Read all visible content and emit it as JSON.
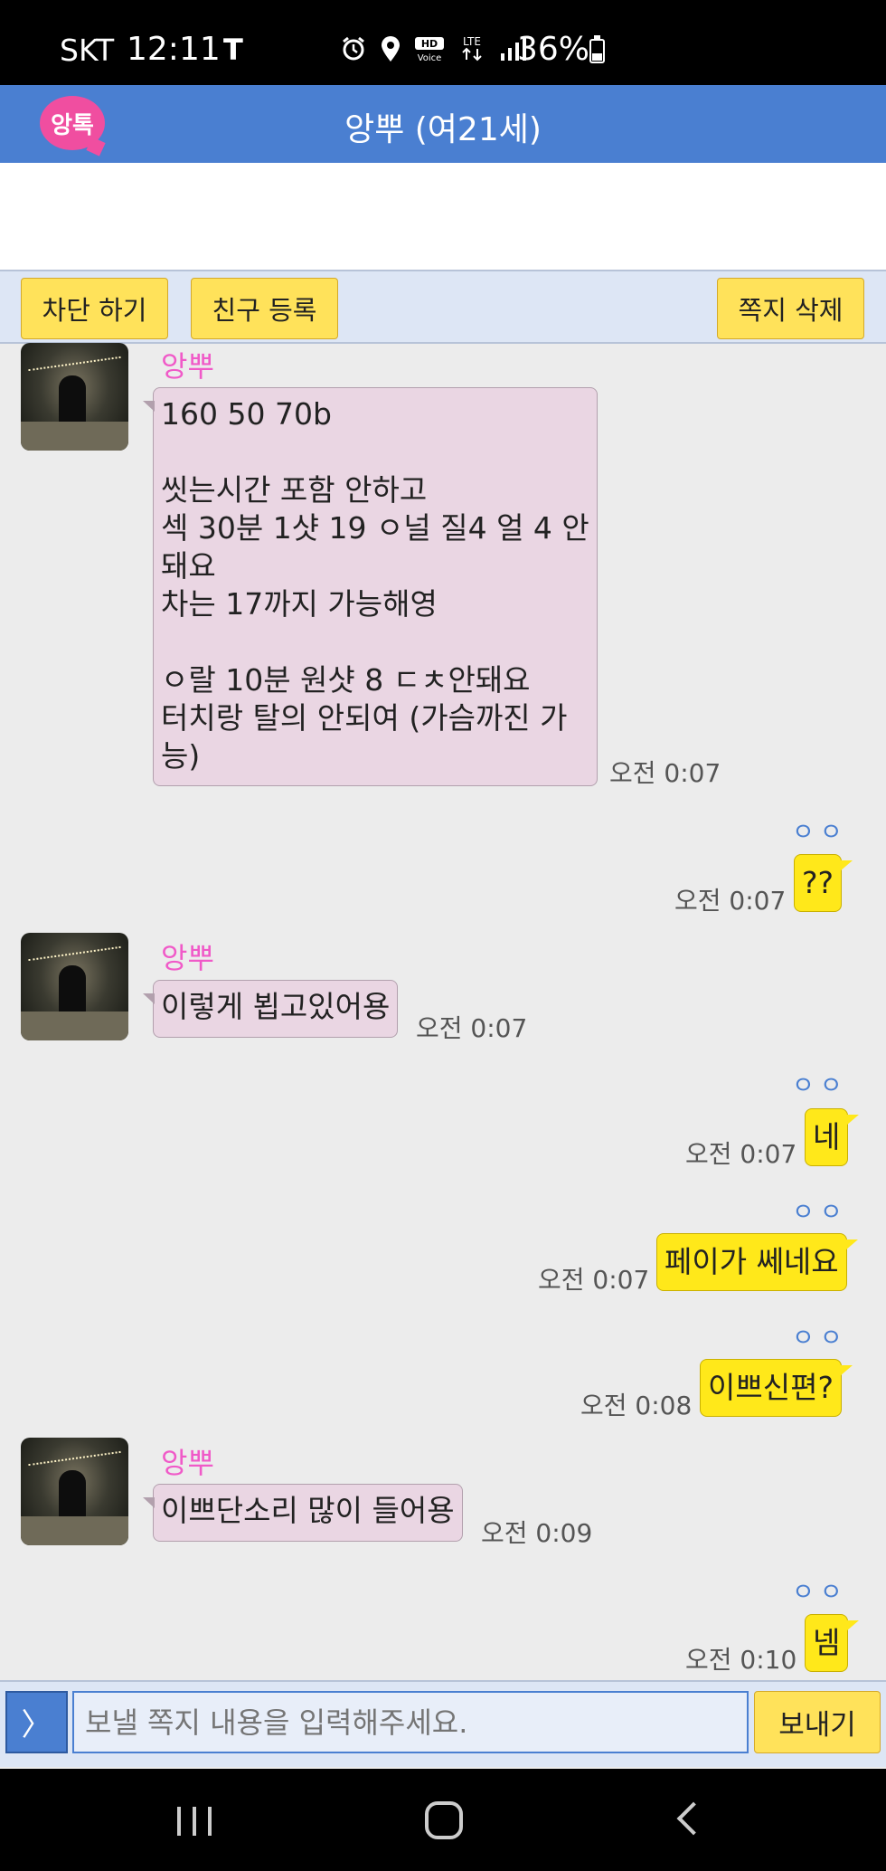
{
  "status_bar": {
    "carrier": "SKT",
    "time": "12:11",
    "carrier_icon": "T",
    "icons": [
      "alarm-icon",
      "location-icon",
      "hd-voice-icon",
      "lte-icon",
      "signal-icon"
    ],
    "battery": "36%"
  },
  "header": {
    "logo_text": "앙톡",
    "title": "앙뿌 (여21세)"
  },
  "toolbar": {
    "block_label": "차단 하기",
    "friend_label": "친구 등록",
    "delete_label": "쪽지 삭제"
  },
  "messages": [
    {
      "dir": "in",
      "sender": "앙뿌",
      "text": "160 50 70b\n\n씻는시간 포함 안하고\n섹 30분 1샷 19 ㅇ널 질4 얼 4 안돼요\n차는 17까지 가능해영\n\nㅇ랄 10분 원샷 8 ㄷㅊ안돼요\n터치랑 탈의 안되여 (가슴까진 가능)",
      "time": "오전 0:07"
    },
    {
      "dir": "out",
      "read": "ㅇㅇ",
      "text": "??",
      "time": "오전 0:07"
    },
    {
      "dir": "in",
      "sender": "앙뿌",
      "text": "이렇게 뵙고있어용",
      "time": "오전 0:07"
    },
    {
      "dir": "out",
      "read": "ㅇㅇ",
      "text": "네",
      "time": "오전 0:07"
    },
    {
      "dir": "out",
      "read": "ㅇㅇ",
      "text": "페이가 쎄네요",
      "time": "오전 0:07"
    },
    {
      "dir": "out",
      "read": "ㅇㅇ",
      "text": "이쁘신편?",
      "time": "오전 0:08"
    },
    {
      "dir": "in",
      "sender": "앙뿌",
      "text": "이쁘단소리 많이 들어용",
      "time": "오전 0:09"
    },
    {
      "dir": "out",
      "read": "ㅇㅇ",
      "text": "넴",
      "time": "오전 0:10"
    }
  ],
  "input": {
    "expand_label": "〉",
    "placeholder": "보낼 쪽지 내용을 입력해주세요.",
    "send_label": "보내기"
  },
  "nav": {
    "recent": "recent-apps-icon",
    "home": "home-icon",
    "back": "back-icon"
  }
}
